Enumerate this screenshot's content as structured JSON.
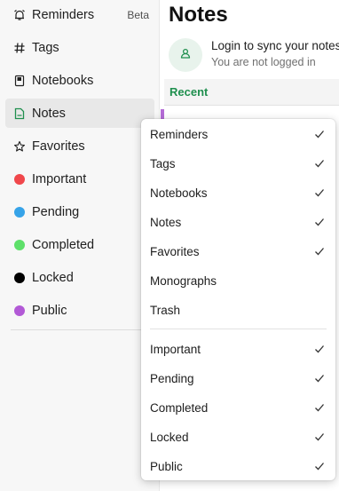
{
  "sidebar": {
    "items": [
      {
        "label": "Reminders",
        "badge": "Beta",
        "icon": "alarm-icon"
      },
      {
        "label": "Tags",
        "icon": "hash-icon"
      },
      {
        "label": "Notebooks",
        "icon": "notebook-icon"
      },
      {
        "label": "Notes",
        "icon": "note-icon",
        "active": true
      },
      {
        "label": "Favorites",
        "icon": "star-icon"
      },
      {
        "label": "Important",
        "color": "#f0474b"
      },
      {
        "label": "Pending",
        "color": "#36a3e8"
      },
      {
        "label": "Completed",
        "color": "#5ee06a"
      },
      {
        "label": "Locked",
        "color": "#000000"
      },
      {
        "label": "Public",
        "color": "#b259d6"
      }
    ]
  },
  "main": {
    "title": "Notes",
    "sync": {
      "title": "Login to sync your notes",
      "subtitle": "You are not logged in",
      "icon": "user-icon"
    },
    "recent_label": "Recent"
  },
  "menu": {
    "items": [
      {
        "label": "Reminders",
        "checked": true
      },
      {
        "label": "Tags",
        "checked": true
      },
      {
        "label": "Notebooks",
        "checked": true
      },
      {
        "label": "Notes",
        "checked": true
      },
      {
        "label": "Favorites",
        "checked": true
      },
      {
        "label": "Monographs",
        "checked": false
      },
      {
        "label": "Trash",
        "checked": false
      },
      {
        "label": "Important",
        "checked": true
      },
      {
        "label": "Pending",
        "checked": true
      },
      {
        "label": "Completed",
        "checked": true
      },
      {
        "label": "Locked",
        "checked": true
      },
      {
        "label": "Public",
        "checked": true
      }
    ]
  },
  "colors": {
    "accent": "#1f8f4e",
    "active_background": "#e8e8e8"
  }
}
